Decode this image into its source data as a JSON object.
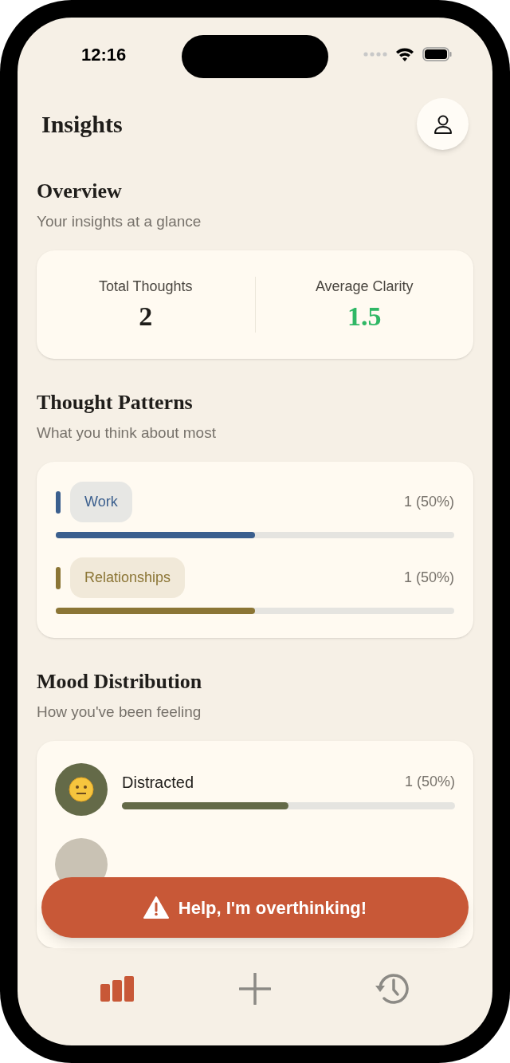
{
  "status_bar": {
    "time": "12:16"
  },
  "header": {
    "title": "Insights"
  },
  "overview": {
    "title": "Overview",
    "subtitle": "Your insights at a glance",
    "stats": [
      {
        "label": "Total Thoughts",
        "value": "2",
        "kind": "plain"
      },
      {
        "label": "Average Clarity",
        "value": "1.5",
        "kind": "highlight"
      }
    ]
  },
  "thought_patterns": {
    "title": "Thought Patterns",
    "subtitle": "What you think about most",
    "items": [
      {
        "label": "Work",
        "count": "1 (50%)",
        "level": 0.5,
        "color": "#3b5f8e"
      },
      {
        "label": "Relationships",
        "count": "1 (50%)",
        "level": 0.5,
        "color": "#8b7535"
      }
    ]
  },
  "mood_distribution": {
    "title": "Mood Distribution",
    "subtitle": "How you've been feeling",
    "items": [
      {
        "label": "Distracted",
        "count": "1 (50%)",
        "level": 0.5,
        "color": "#646a48"
      }
    ]
  },
  "help_button": {
    "label": "Help, I'm overthinking!"
  },
  "tab_bar": [
    {
      "kind": "insights",
      "selected": true
    },
    {
      "kind": "add",
      "selected": false
    },
    {
      "kind": "history",
      "selected": false
    }
  ]
}
